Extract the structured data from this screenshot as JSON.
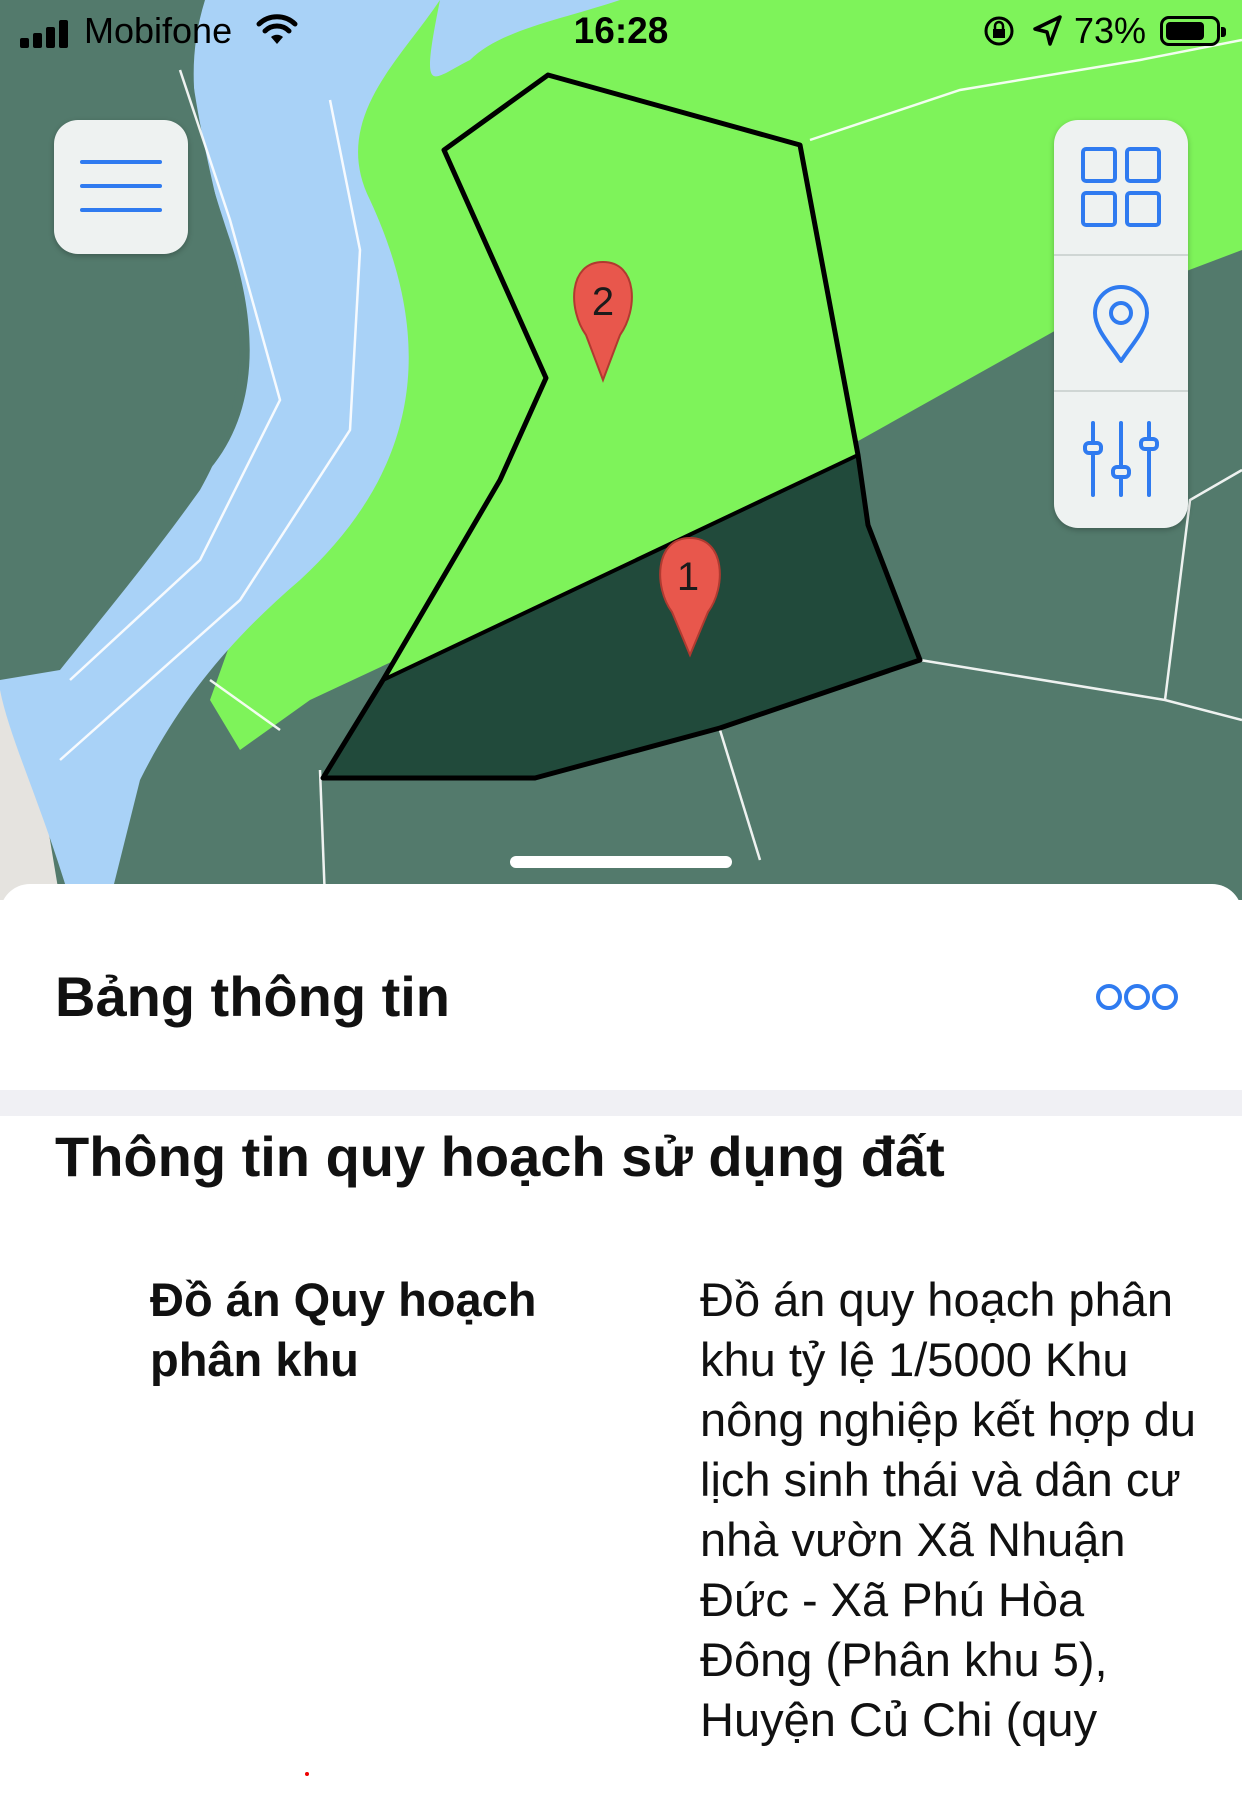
{
  "status_bar": {
    "carrier": "Mobifone",
    "time": "16:28",
    "battery_percent": "73%"
  },
  "map": {
    "markers": [
      {
        "label": "2"
      },
      {
        "label": "1"
      }
    ],
    "colors": {
      "light_green": "#7ef35a",
      "dark_green": "#214a3b",
      "gray_green": "#537a6c",
      "water": "#a9d2f7"
    }
  },
  "controls": {
    "menu_icon": "hamburger-menu-icon",
    "layers_icon": "grid-layers-icon",
    "location_icon": "location-pin-icon",
    "filter_icon": "sliders-filter-icon",
    "accent": "#2f7bf0"
  },
  "panel": {
    "title": "Bảng thông tin",
    "more_icon": "more-dots-icon",
    "section_title": "Thông tin quy hoạch sử dụng đất",
    "row": {
      "label": "Đồ án Quy hoạch phân khu",
      "value": "Đồ án quy hoạch phân khu tỷ lệ 1/5000 Khu nông nghiệp kết hợp du lịch sinh thái và dân cư nhà vườn Xã Nhuận Đức - Xã Phú Hòa Đông (Phân khu 5), Huyện Củ Chi (quy"
    }
  }
}
